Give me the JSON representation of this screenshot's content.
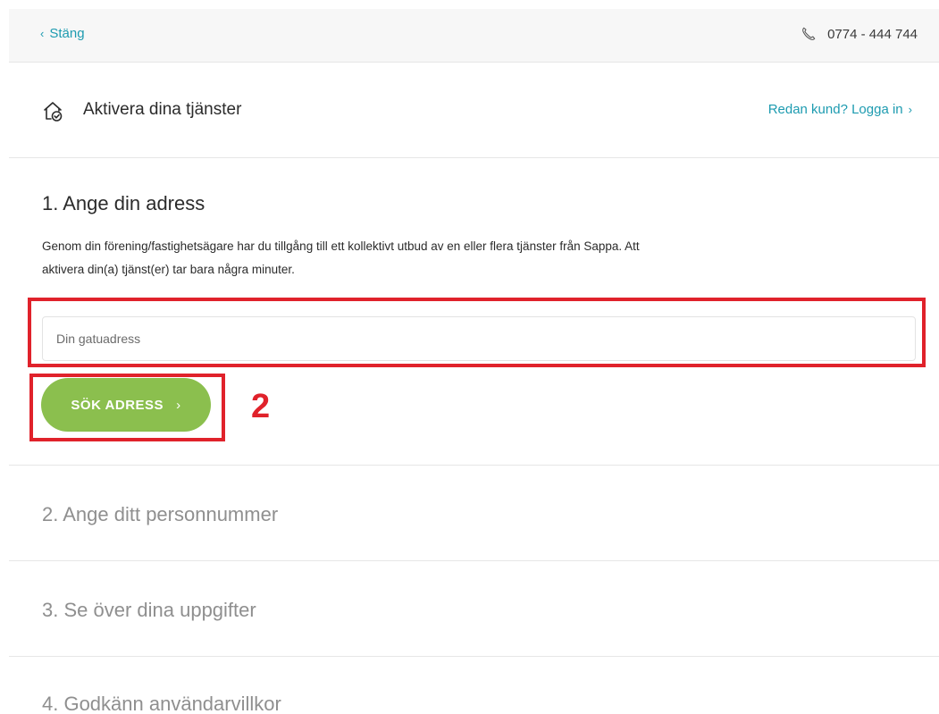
{
  "topbar": {
    "close_label": "Stäng",
    "phone_number": "0774 - 444 744",
    "phone_icon": "phone-icon"
  },
  "activation": {
    "icon": "house-check-icon",
    "title": "Aktivera dina tjänster",
    "login_link": "Redan kund? Logga in"
  },
  "step1": {
    "title": "1. Ange din adress",
    "description": "Genom din förening/fastighetsägare har du tillgång till ett kollektivt utbud av en eller flera tjänster från Sappa. Att aktivera din(a) tjänst(er) tar bara några minuter.",
    "address_input": {
      "placeholder": "Din gatuadress",
      "value": ""
    },
    "search_button": "SÖK ADRESS"
  },
  "annotation": {
    "number": "2",
    "color": "#e0222b"
  },
  "steps": [
    {
      "title": "2. Ange ditt personnummer"
    },
    {
      "title": "3. Se över dina uppgifter"
    },
    {
      "title": "4. Godkänn användarvillkor"
    }
  ],
  "colors": {
    "accent": "#1d9bb0",
    "button": "#8bbf4e",
    "muted_text": "#8f8f8f"
  }
}
